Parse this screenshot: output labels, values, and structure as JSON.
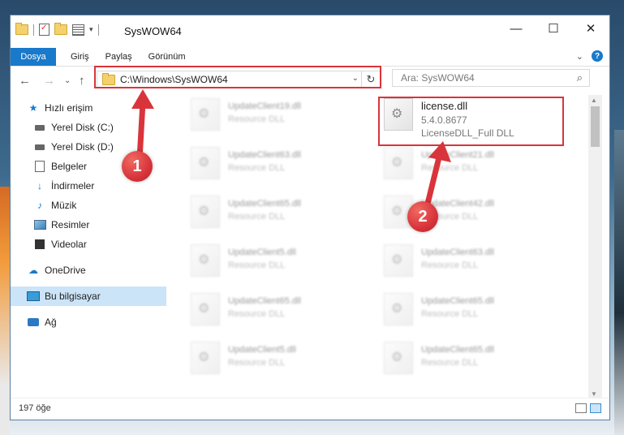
{
  "window": {
    "title": "SysWOW64",
    "controls": {
      "minimize": "—",
      "maximize": "☐",
      "close": "✕"
    }
  },
  "ribbon": {
    "tabs": [
      "Dosya",
      "Giriş",
      "Paylaş",
      "Görünüm"
    ],
    "help": "?",
    "expand": "⌄"
  },
  "nav": {
    "back": "←",
    "forward": "→",
    "recent": "⌄",
    "up": "↑"
  },
  "address": {
    "path": "C:\\Windows\\SysWOW64",
    "dropdown": "⌄",
    "refresh": "↻"
  },
  "search": {
    "placeholder": "Ara: SysWOW64",
    "icon": "search-icon"
  },
  "sidebar": {
    "items": [
      {
        "label": "Hızlı erişim",
        "icon": "star-icon",
        "pinned": false
      },
      {
        "label": "Yerel Disk (C:)",
        "icon": "disk-icon",
        "pinned": true
      },
      {
        "label": "Yerel Disk (D:)",
        "icon": "disk-icon",
        "pinned": true
      },
      {
        "label": "Belgeler",
        "icon": "document-icon",
        "pinned": true
      },
      {
        "label": "İndirmeler",
        "icon": "download-icon",
        "pinned": true
      },
      {
        "label": "Müzik",
        "icon": "music-icon",
        "pinned": true
      },
      {
        "label": "Resimler",
        "icon": "pictures-icon",
        "pinned": true
      },
      {
        "label": "Videolar",
        "icon": "video-icon",
        "pinned": true
      },
      {
        "label": "OneDrive",
        "icon": "cloud-icon",
        "pinned": false
      },
      {
        "label": "Bu bilgisayar",
        "icon": "computer-icon",
        "pinned": false,
        "selected": true
      },
      {
        "label": "Ağ",
        "icon": "network-icon",
        "pinned": false
      }
    ],
    "pin_glyph": "📌"
  },
  "files": {
    "highlighted": {
      "name": "license.dll",
      "version": "5.4.0.8677",
      "description": "LicenseDLL_Full DLL"
    },
    "left_column": [
      {
        "name": "UpdateClient19.dll",
        "type": "Resource DLL"
      },
      {
        "name": "UpdateClient63.dll",
        "type": "Resource DLL"
      },
      {
        "name": "UpdateClient65.dll",
        "type": "Resource DLL"
      },
      {
        "name": "UpdateClient5.dll",
        "type": "Resource DLL"
      },
      {
        "name": "UpdateClient65.dll",
        "type": "Resource DLL"
      },
      {
        "name": "UpdateClient5.dll",
        "type": "Resource DLL"
      }
    ],
    "right_column": [
      {
        "name": "UpdateClient21.dll",
        "type": "Resource DLL"
      },
      {
        "name": "UpdateClient42.dll",
        "type": "Resource DLL"
      },
      {
        "name": "UpdateClient63.dll",
        "type": "Resource DLL"
      },
      {
        "name": "UpdateClient65.dll",
        "type": "Resource DLL"
      },
      {
        "name": "UpdateClient65.dll",
        "type": "Resource DLL"
      }
    ]
  },
  "status": {
    "item_count": "197 öğe"
  },
  "annotations": {
    "step1": "1",
    "step2": "2",
    "color": "#d9343b"
  }
}
